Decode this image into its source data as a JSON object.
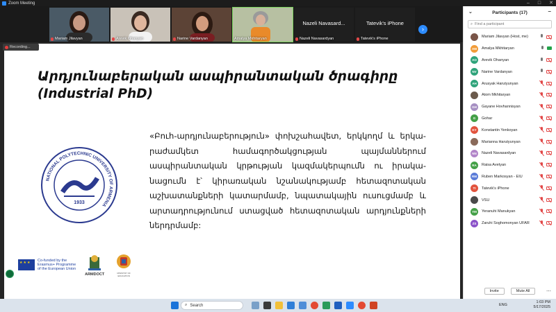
{
  "window": {
    "title": "Zoom Meeting"
  },
  "video_strip": {
    "tiles": [
      {
        "name": "Mariam Jilavyan",
        "muted": true,
        "photo_bg": "#4a5a66",
        "skin": "#c99a84",
        "hair": "#2a1a14"
      },
      {
        "name": "Arevik Ohanyan",
        "muted": true,
        "photo_bg": "#c9c2b8",
        "skin": "#e0b69d",
        "hair": "#3a2a22"
      },
      {
        "name": "Narine Vardanyan",
        "muted": true,
        "photo_bg": "#5c4336",
        "skin": "#d39c7e",
        "hair": "#2c1a12"
      },
      {
        "name": "Amalya Mkhitaryan",
        "muted": false,
        "photo_bg": "#b7c0a2",
        "skin": "#d8b19a",
        "hair": "#9a9a9a"
      }
    ],
    "name_tiles": [
      {
        "big": "Nazeli Navasard...",
        "small": "Nazeli Navasardyan"
      },
      {
        "big": "Tatevik's iPhone",
        "small": "Tatevik's iPhone"
      }
    ]
  },
  "recording_label": "Recording...",
  "slide": {
    "title_line1": "Արդյունաբերական ասպիրանտական ծրագիրը",
    "title_line2": "(Industrial PhD)",
    "body": "«Բուհ-արդյունաբերություն» փոխշահավետ, երկկողմ և երկա-րաժամկետ համագործակցության պայմաններում ասպիրանտական կրթության կազմակերպումն ու իրակա-նացումն է՝ կիրառական նշանակությամբ հետազոտական աշխատանքների կատարմամբ, նպատակային ուսուցմամբ և արտադրությունում ստացված հետազոտական արդյունքների ներդրմամբ:",
    "emblem": {
      "year": "1933",
      "ring_text": "NATIONAL POLYTECHNIC UNIVERSITY OF ARMENIA"
    },
    "eu_text_1": "Co-funded by the",
    "eu_text_2": "Erasmus+ Programme",
    "eu_text_3": "of the European Union",
    "armdoct_label": "ARMDOCT",
    "ministry_label": "MINISTRY OF EDUCATION"
  },
  "participants": {
    "title": "Participants (17)",
    "search_placeholder": "Find a participant",
    "list": [
      {
        "name": "Mariam Jilavyan (Host, me)",
        "initials": "",
        "color": "#7a5548",
        "mic": "on",
        "cam": "off"
      },
      {
        "name": "Amalya Mkhitaryan",
        "initials": "AM",
        "color": "#f29c38",
        "mic": "on",
        "cam": "on"
      },
      {
        "name": "Arevik Ohanyan",
        "initials": "AO",
        "color": "#2fa37a",
        "mic": "on",
        "cam": "off"
      },
      {
        "name": "Narine Vardanyan",
        "initials": "NV",
        "color": "#2fa37a",
        "mic": "on",
        "cam": "off"
      },
      {
        "name": "Arusyak Harutyunyan",
        "initials": "AH",
        "color": "#2fa37a",
        "mic": "off",
        "cam": "off"
      },
      {
        "name": "Atom Mkhitaryan",
        "initials": "",
        "color": "#6b5a4c",
        "mic": "off",
        "cam": "off"
      },
      {
        "name": "Gayane Hovhannisyan",
        "initials": "GH",
        "color": "#a68fc2",
        "mic": "off",
        "cam": "off"
      },
      {
        "name": "Gohar",
        "initials": "G",
        "color": "#44a047",
        "mic": "off",
        "cam": "off"
      },
      {
        "name": "Konstantin Yenkoyan",
        "initials": "KY",
        "color": "#e2533d",
        "mic": "off",
        "cam": "off"
      },
      {
        "name": "Marianna Harutyunyan",
        "initials": "",
        "color": "#8a6a5a",
        "mic": "off",
        "cam": "off"
      },
      {
        "name": "Nazeli Navasardyan",
        "initials": "NN",
        "color": "#b184c8",
        "mic": "off",
        "cam": "off"
      },
      {
        "name": "Raisa Avetyan",
        "initials": "RA",
        "color": "#44a047",
        "mic": "off",
        "cam": "off"
      },
      {
        "name": "Ruben Markosyan - EIU",
        "initials": "RM",
        "color": "#5a7bd8",
        "mic": "off",
        "cam": "off"
      },
      {
        "name": "Tatevik's iPhone",
        "initials": "TI",
        "color": "#e2533d",
        "mic": "off",
        "cam": "off"
      },
      {
        "name": "VSU",
        "initials": "",
        "color": "#4a4a4a",
        "mic": "off",
        "cam": "off"
      },
      {
        "name": "Yeranuhi Manukyan",
        "initials": "YM",
        "color": "#44a047",
        "mic": "off",
        "cam": "off"
      },
      {
        "name": "Zaruhi Soghomonyan UFAR",
        "initials": "ZS",
        "color": "#8b52c9",
        "mic": "off",
        "cam": "off"
      }
    ],
    "invite_label": "Invite",
    "mute_all_label": "Mute All"
  },
  "taskbar": {
    "search_placeholder": "Search",
    "lang": "ENG",
    "time": "1:03 PM",
    "date": "5/17/2025"
  }
}
